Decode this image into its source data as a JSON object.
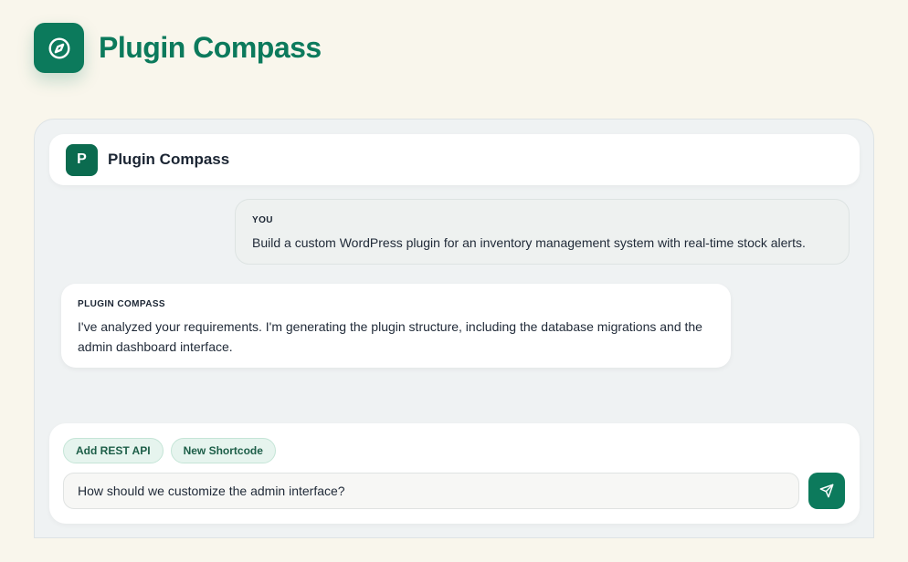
{
  "app": {
    "title": "Plugin Compass",
    "logo_icon": "compass-icon"
  },
  "chat": {
    "header": {
      "avatar_letter": "P",
      "title": "Plugin Compass"
    },
    "messages": [
      {
        "sender": "YOU",
        "text": "Build a custom WordPress plugin for an inventory management system with real-time stock alerts."
      },
      {
        "sender": "PLUGIN COMPASS",
        "text": "I've analyzed your requirements. I'm generating the plugin structure, including the database migrations and the admin dashboard interface."
      }
    ]
  },
  "composer": {
    "chips": [
      "Add REST API",
      "New Shortcode"
    ],
    "input_value": "How should we customize the admin interface?",
    "send_icon": "send-icon"
  },
  "colors": {
    "brand": "#0c7a5c",
    "background": "#f9f6ec",
    "panel": "#eff2f3"
  }
}
